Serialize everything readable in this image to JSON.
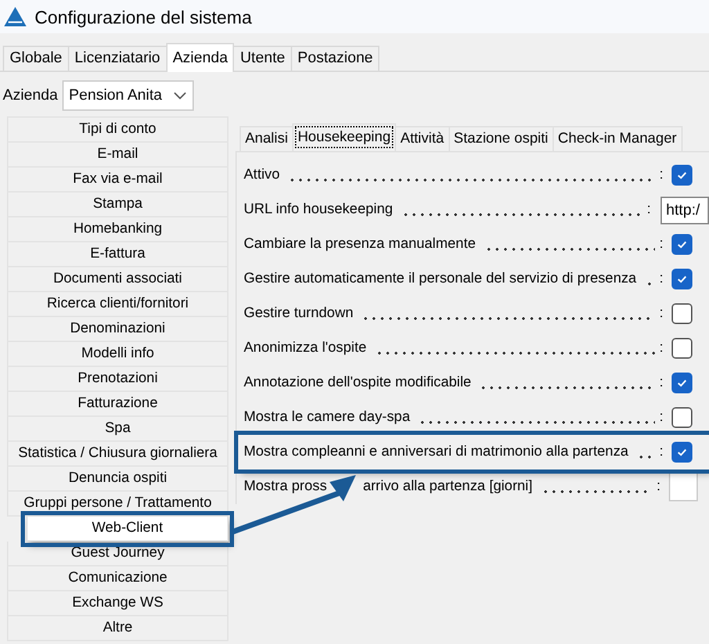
{
  "window": {
    "title": "Configurazione del sistema"
  },
  "tabs": [
    {
      "label": "Globale",
      "selected": false
    },
    {
      "label": "Licenziatario",
      "selected": false
    },
    {
      "label": "Azienda",
      "selected": true
    },
    {
      "label": "Utente",
      "selected": false
    },
    {
      "label": "Postazione",
      "selected": false
    }
  ],
  "company": {
    "label": "Azienda",
    "value": "Pension Anita"
  },
  "sidebar": {
    "items": [
      {
        "label": "Tipi di conto",
        "selected": false,
        "highlighted": false
      },
      {
        "label": "E-mail",
        "selected": false,
        "highlighted": false
      },
      {
        "label": "Fax via e-mail",
        "selected": false,
        "highlighted": false
      },
      {
        "label": "Stampa",
        "selected": false,
        "highlighted": false
      },
      {
        "label": "Homebanking",
        "selected": false,
        "highlighted": false
      },
      {
        "label": "E-fattura",
        "selected": false,
        "highlighted": false
      },
      {
        "label": "Documenti associati",
        "selected": false,
        "highlighted": false
      },
      {
        "label": "Ricerca clienti/fornitori",
        "selected": false,
        "highlighted": false
      },
      {
        "label": "Denominazioni",
        "selected": false,
        "highlighted": false
      },
      {
        "label": "Modelli info",
        "selected": false,
        "highlighted": false
      },
      {
        "label": "Prenotazioni",
        "selected": false,
        "highlighted": false
      },
      {
        "label": "Fatturazione",
        "selected": false,
        "highlighted": false
      },
      {
        "label": "Spa",
        "selected": false,
        "highlighted": false
      },
      {
        "label": "Statistica / Chiusura giornaliera",
        "selected": false,
        "highlighted": false
      },
      {
        "label": "Denuncia ospiti",
        "selected": false,
        "highlighted": false
      },
      {
        "label": "Gruppi persone / Trattamento",
        "selected": false,
        "highlighted": false
      },
      {
        "label": "Web-Client",
        "selected": true,
        "highlighted": true
      },
      {
        "label": "Guest Journey",
        "selected": false,
        "highlighted": false
      },
      {
        "label": "Comunicazione",
        "selected": false,
        "highlighted": false
      },
      {
        "label": "Exchange WS",
        "selected": false,
        "highlighted": false
      },
      {
        "label": "Altre",
        "selected": false,
        "highlighted": false
      }
    ]
  },
  "subtabs": [
    {
      "label": "Analisi",
      "selected": false
    },
    {
      "label": "Housekeeping",
      "selected": true
    },
    {
      "label": "Attività",
      "selected": false
    },
    {
      "label": "Stazione ospiti",
      "selected": false
    },
    {
      "label": "Check-in Manager",
      "selected": false
    }
  ],
  "settings": [
    {
      "kind": "checkbox",
      "label": "Attivo",
      "colon": ":",
      "checked": true,
      "highlighted": false
    },
    {
      "kind": "text",
      "label": "URL info housekeeping",
      "colon": ":",
      "value": "http:/",
      "highlighted": false
    },
    {
      "kind": "checkbox",
      "label": "Cambiare la presenza manualmente",
      "colon": ":",
      "checked": true,
      "highlighted": false
    },
    {
      "kind": "checkbox",
      "label": "Gestire automaticamente il personale del servizio di presenza",
      "colon": ":",
      "checked": true,
      "highlighted": false
    },
    {
      "kind": "checkbox",
      "label": "Gestire turndown",
      "colon": ":",
      "checked": false,
      "highlighted": false
    },
    {
      "kind": "checkbox",
      "label": "Anonimizza l'ospite",
      "colon": ":",
      "checked": false,
      "highlighted": false
    },
    {
      "kind": "checkbox",
      "label": "Annotazione dell'ospite modificabile",
      "colon": ":",
      "checked": true,
      "highlighted": false
    },
    {
      "kind": "checkbox",
      "label": "Mostra le camere day-spa",
      "colon": ":",
      "checked": false,
      "highlighted": false
    },
    {
      "kind": "checkbox",
      "label": "Mostra compleanni e anniversari di matrimonio alla partenza",
      "colon": ":",
      "checked": true,
      "highlighted": true
    },
    {
      "kind": "number",
      "label": "Mostra pross",
      "label_after_arrow": "arrivo alla partenza [giorni]",
      "colon": ":",
      "highlighted": false
    }
  ]
}
